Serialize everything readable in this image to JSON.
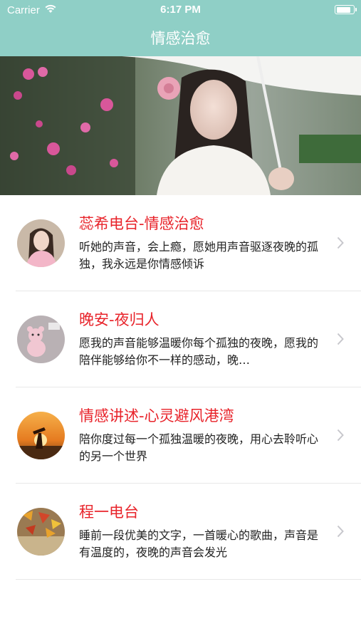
{
  "status_bar": {
    "carrier": "Carrier",
    "time": "6:17 PM"
  },
  "nav": {
    "title": "情感治愈"
  },
  "banner": {
    "image": "banner-photo-woman-umbrella-flowers"
  },
  "items": [
    {
      "title": "蕊希电台-情感治愈",
      "description": "听她的声音，会上瘾，愿她用声音驱逐夜晚的孤独，我永远是你情感倾诉",
      "avatar": "avatar-girl-portrait"
    },
    {
      "title": "晚安-夜归人",
      "description": "愿我的声音能够温暖你每个孤独的夜晚，愿我的陪伴能够给你不一样的感动，晚…",
      "avatar": "avatar-teddy-bear"
    },
    {
      "title": "情感讲述-心灵避风港湾",
      "description": "陪你度过每一个孤独温暖的夜晚，用心去聆听心的另一个世界",
      "avatar": "avatar-sunset-couple"
    },
    {
      "title": "程一电台",
      "description": "睡前一段优美的文字，一首暖心的歌曲，声音是有温度的，夜晚的声音会发光",
      "avatar": "avatar-autumn-leaves"
    }
  ],
  "colors": {
    "header": "#8fcfc6",
    "title": "#e8232a"
  }
}
